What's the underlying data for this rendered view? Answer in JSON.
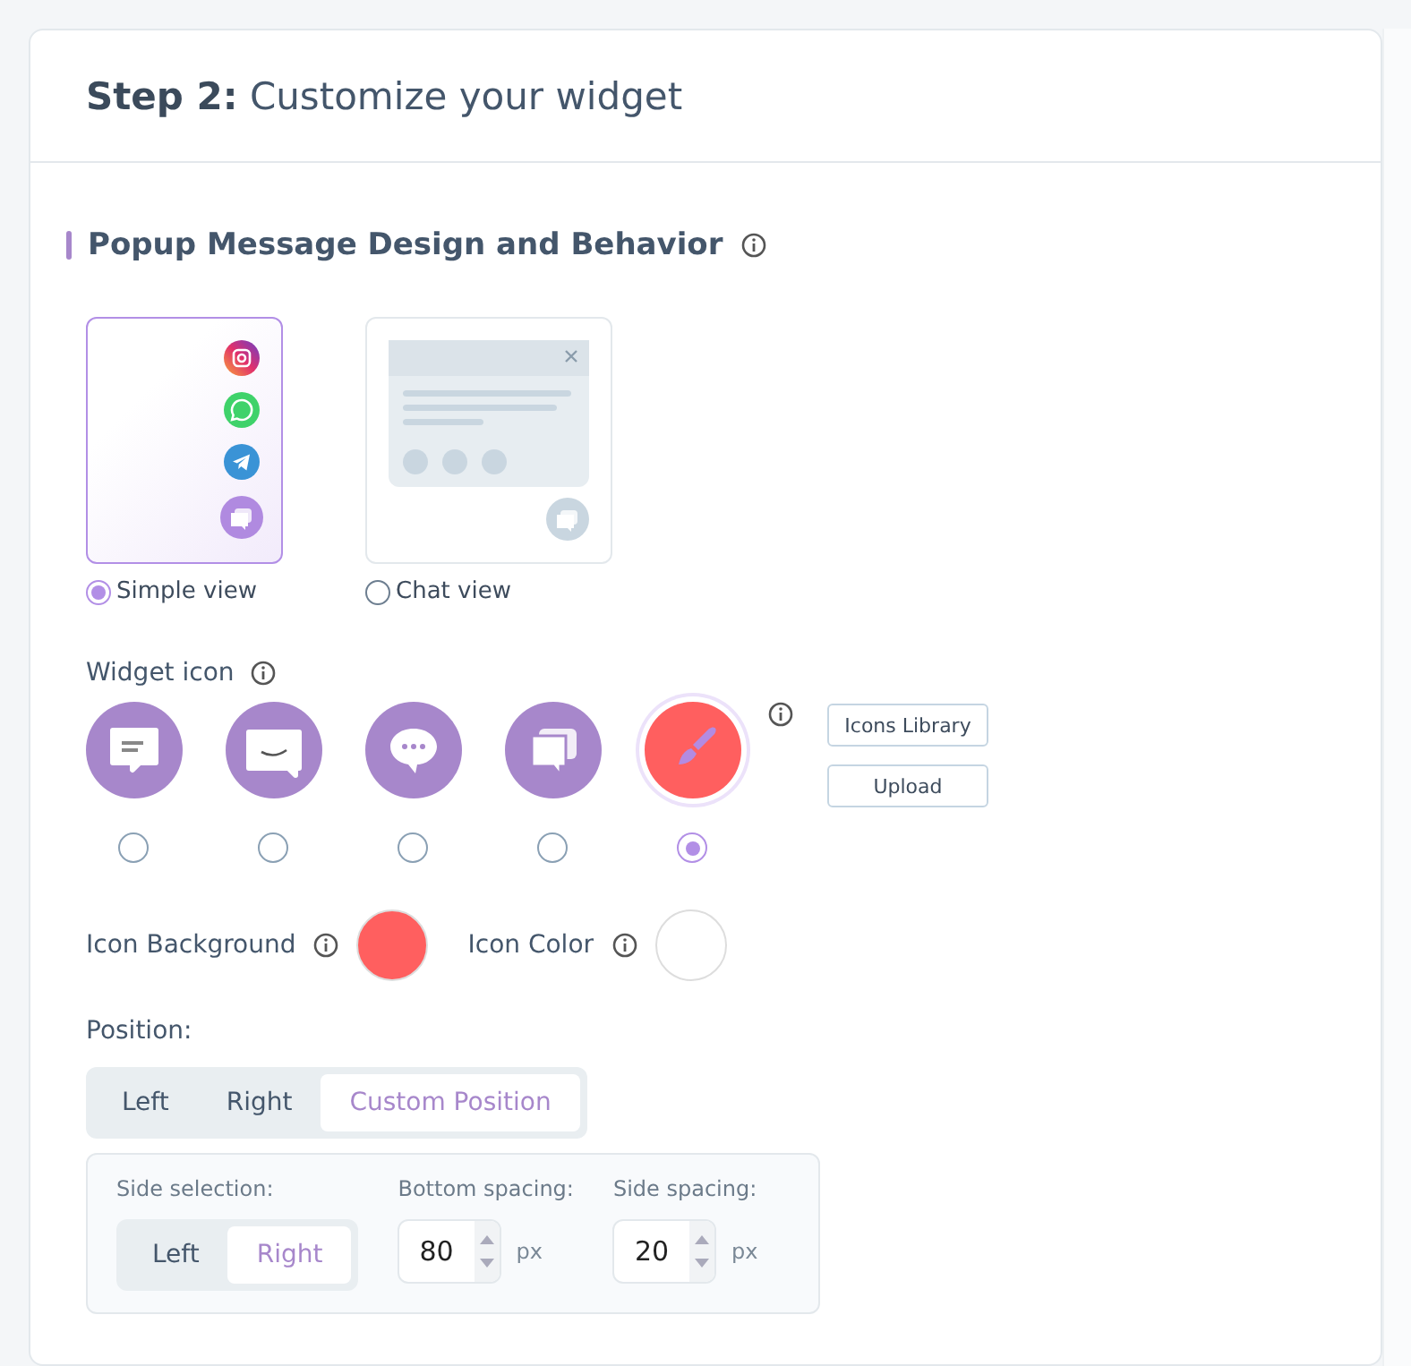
{
  "header": {
    "title": "**Step 2:** Customize your widget"
  },
  "section": {
    "title": "Popup Message Design and Behavior"
  },
  "views": [
    {
      "kind": "simple",
      "label": "Simple view",
      "selected": true
    },
    {
      "kind": "chat",
      "label": "Chat view",
      "selected": false
    }
  ],
  "widget_icon": {
    "label": "Widget icon",
    "icons": [
      {
        "kind": "lines",
        "color": "#a787cb",
        "selected": false
      },
      {
        "kind": "smile",
        "color": "#a787cb",
        "selected": false
      },
      {
        "kind": "dots",
        "color": "#a787cb",
        "selected": false
      },
      {
        "kind": "stack",
        "color": "#a787cb",
        "selected": false
      },
      {
        "kind": "brush",
        "color": "#ff5f5f",
        "selected": true
      }
    ],
    "buttons": [
      "Icons Library",
      "Upload"
    ]
  },
  "colors": [
    {
      "label": "Icon Background",
      "color": "#ff5f5f"
    },
    {
      "label": "Icon Color",
      "color": "#ffffff"
    }
  ],
  "position": {
    "label": "Position:",
    "options": [
      {
        "label": "Left",
        "selected": false
      },
      {
        "label": "Right",
        "selected": false
      },
      {
        "label": "Custom Position",
        "selected": true
      }
    ],
    "custom": {
      "side_label": "Side selection:",
      "side_options": [
        {
          "label": "Left",
          "selected": false
        },
        {
          "label": "Right",
          "selected": true
        }
      ],
      "spacings": [
        {
          "label": "Bottom spacing:",
          "value": "80",
          "unit": "px"
        },
        {
          "label": "Side spacing:",
          "value": "20",
          "unit": "px"
        }
      ]
    }
  }
}
